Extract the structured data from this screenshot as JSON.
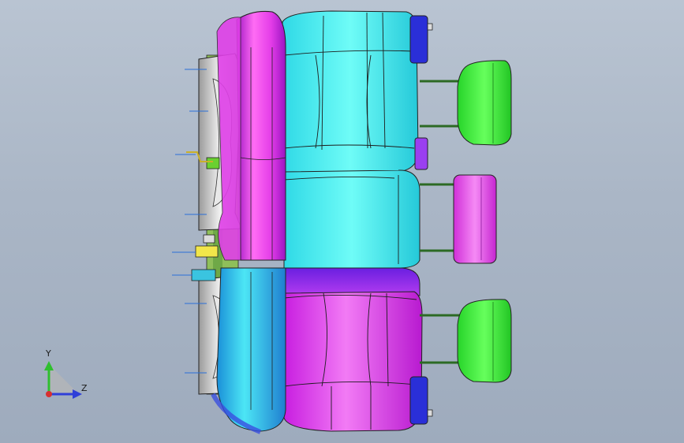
{
  "viewport": {
    "colors": {
      "background_top": "#b9c4d2",
      "background_bottom": "#9eabbd",
      "cushion_cyan": "#46f4f2",
      "cushion_magenta": "#e23df0",
      "cushion_purple": "#8a2bf0",
      "headrest_green": "#3ff03a",
      "headrest_pink": "#e44fe8",
      "bracket_blue": "#2a2fd8",
      "frame_gray": "#d8d8d8",
      "edge_dark": "#202020"
    }
  },
  "triad": {
    "y_label": "Y",
    "z_label": "Z",
    "y_color": "#2fbf2f",
    "z_color": "#2f3fd8",
    "x_color": "#d83030"
  }
}
